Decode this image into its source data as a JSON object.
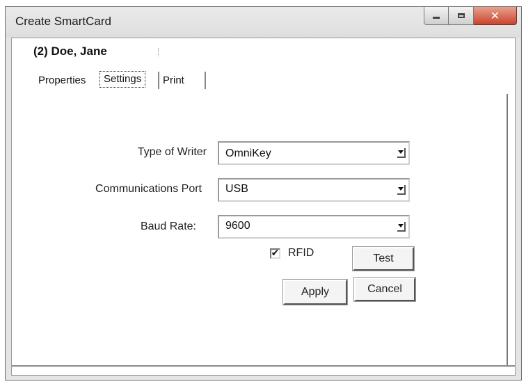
{
  "window": {
    "title": "Create SmartCard",
    "close_glyph": "✕"
  },
  "heading": "(2) Doe, Jane",
  "tabs": [
    {
      "label": "Properties"
    },
    {
      "label": "Settings"
    },
    {
      "label": "Print"
    }
  ],
  "form": {
    "writer": {
      "label": "Type of Writer",
      "value": "OmniKey"
    },
    "port": {
      "label": "Communications Port",
      "value": "USB"
    },
    "baud": {
      "label": "Baud Rate:",
      "value": "9600"
    },
    "rfid": {
      "label": "RFID",
      "checked": true
    }
  },
  "buttons": {
    "test": "Test",
    "apply": "Apply",
    "cancel": "Cancel"
  },
  "icons": {
    "minimize": "minimize-icon",
    "maximize": "maximize-icon",
    "close": "close-icon",
    "dropdown": "chevron-down-icon",
    "check": "checkmark-icon"
  },
  "colors": {
    "close_button": "#c8452c",
    "window_frame": "#e4e4e4"
  }
}
